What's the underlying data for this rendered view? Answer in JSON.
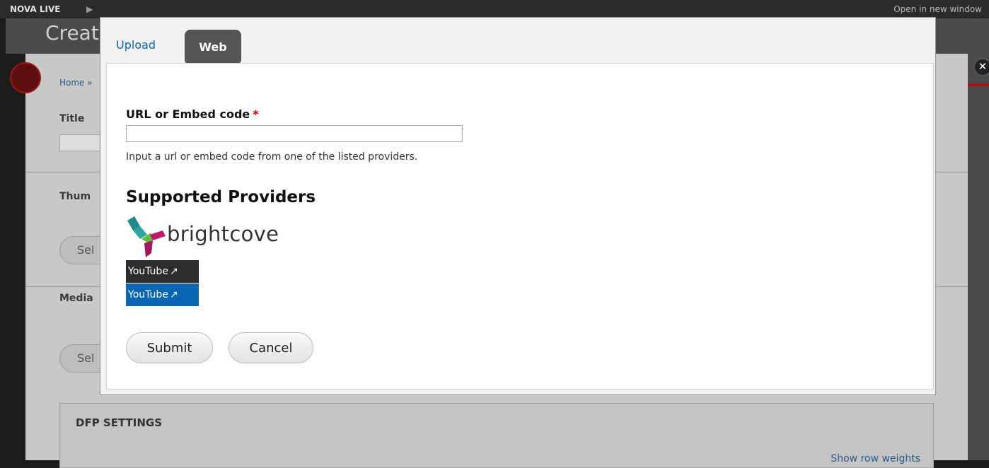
{
  "topbar": {
    "brand": "NOVA LIVE",
    "play_glyph": "▶",
    "ticker": "",
    "open_window": "Open in new window"
  },
  "background": {
    "page_title": "Creat",
    "breadcrumb": "Home »",
    "title_label": "Title",
    "thumbnail_label": "Thum",
    "select_button_1": "Sel",
    "media_label": "Media",
    "select_button_2": "Sel",
    "dfp_settings": "DFP SETTINGS",
    "show_row_weights": "Show row weights"
  },
  "modal": {
    "tabs": [
      {
        "label": "Upload",
        "active": false
      },
      {
        "label": "Web",
        "active": true
      }
    ],
    "url_field": {
      "label": "URL or Embed code",
      "required_marker": "*",
      "value": "",
      "placeholder": "",
      "help": "Input a url or embed code from one of the listed providers."
    },
    "providers": {
      "heading": "Supported Providers",
      "brightcove": "brightcove",
      "youtube_badges": [
        {
          "label": "YouTube",
          "style": "dark"
        },
        {
          "label": "YouTube",
          "style": "blue"
        }
      ],
      "external_glyph": "↗"
    },
    "buttons": {
      "submit": "Submit",
      "cancel": "Cancel"
    },
    "close_glyph": "✕"
  },
  "colors": {
    "link_blue": "#0b66b3",
    "required_red": "#c40000",
    "youtube_blue": "#0a65b3",
    "tab_active_bg": "#555555"
  }
}
